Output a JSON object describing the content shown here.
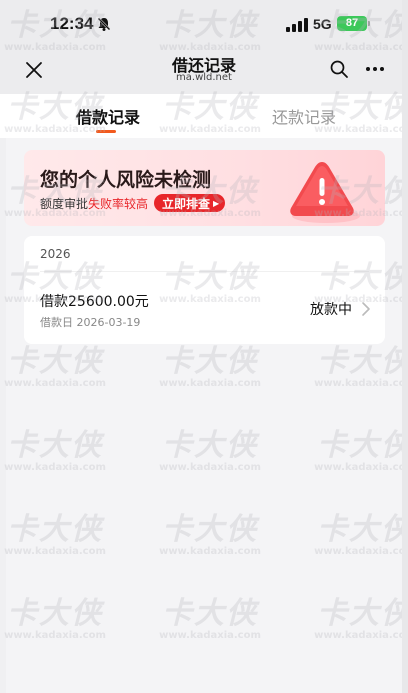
{
  "status_bar": {
    "time": "12:34",
    "network": "5G",
    "battery": "87"
  },
  "nav": {
    "title": "借还记录",
    "subtitle": "ma.wld.net"
  },
  "tabs": [
    {
      "label": "借款记录",
      "active": true
    },
    {
      "label": "还款记录",
      "active": false
    }
  ],
  "risk_banner": {
    "title": "您的个人风险未检测",
    "subtitle_prefix": "额度审批",
    "subtitle_highlight": "失败率较高",
    "button_label": "立即排查"
  },
  "loan": {
    "year": "2026",
    "amount": "借款25600.00元",
    "date": "借款日 2026-03-19",
    "status": "放款中"
  },
  "watermark": {
    "text": "卡大侠",
    "url": "www.kadaxia.com"
  },
  "colors": {
    "accent": "#f25a1e",
    "danger": "#e8262a",
    "battery": "#3cc85a"
  }
}
